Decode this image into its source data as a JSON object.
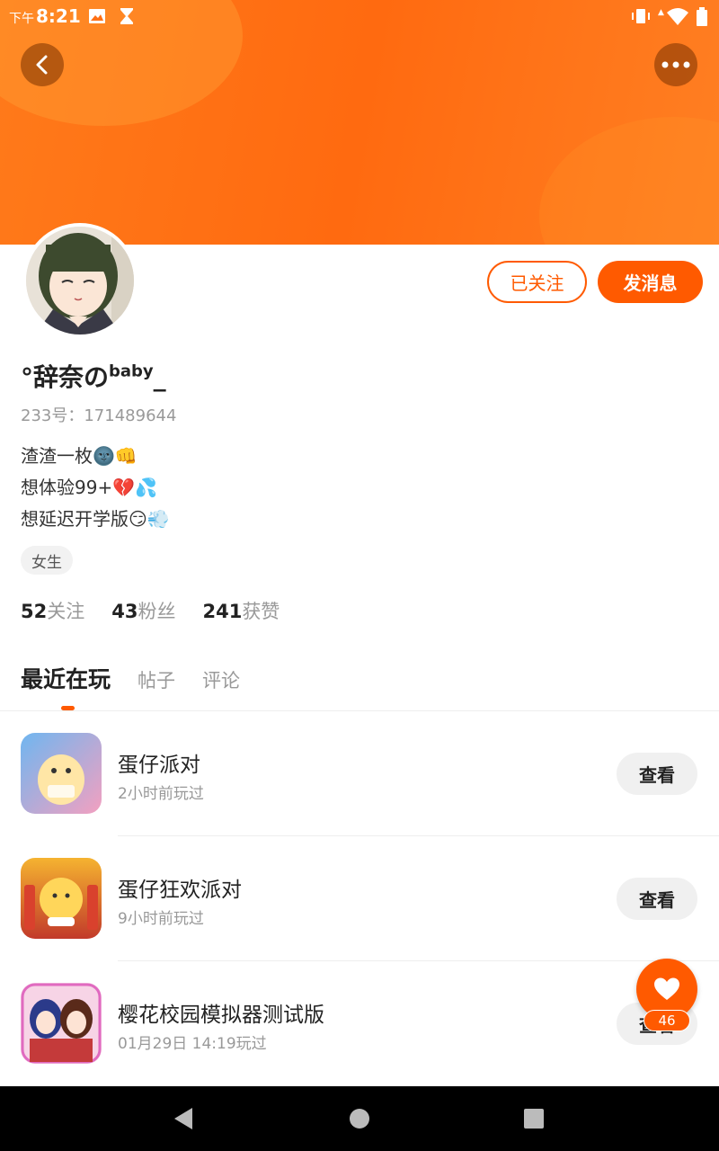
{
  "status_bar": {
    "ampm": "下午",
    "time": "8:21"
  },
  "profile": {
    "follow_label": "已关注",
    "message_label": "发消息",
    "username": "°辞奈の",
    "username_sup": "baby",
    "username_suffix": "_",
    "id_text": "233号：171489644",
    "bio_lines": [
      "渣渣一枚🌚👊",
      "想体验99+💔💦",
      "想延迟开学版😏💨"
    ],
    "tag": "女生",
    "stats": [
      {
        "num": "52",
        "label": "关注"
      },
      {
        "num": "43",
        "label": "粉丝"
      },
      {
        "num": "241",
        "label": "获赞"
      }
    ]
  },
  "tabs": [
    {
      "label": "最近在玩",
      "active": true
    },
    {
      "label": "帖子",
      "active": false
    },
    {
      "label": "评论",
      "active": false
    }
  ],
  "games": [
    {
      "name": "蛋仔派对",
      "time": "2小时前玩过",
      "button": "查看"
    },
    {
      "name": "蛋仔狂欢派对",
      "time": "9小时前玩过",
      "button": "查看"
    },
    {
      "name": "樱花校园模拟器测试版",
      "time": "01月29日 14:19玩过",
      "button": "查看"
    }
  ],
  "like": {
    "count": "46"
  },
  "colors": {
    "accent": "#ff5a00",
    "header": "#ff7014"
  }
}
